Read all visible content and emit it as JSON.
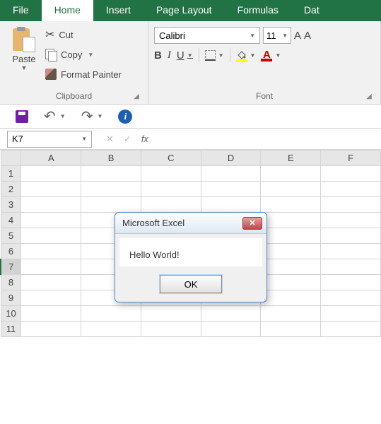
{
  "tabs": {
    "file": "File",
    "home": "Home",
    "insert": "Insert",
    "pagelayout": "Page Layout",
    "formulas": "Formulas",
    "data": "Dat"
  },
  "clipboard": {
    "paste": "Paste",
    "cut": "Cut",
    "copy": "Copy",
    "format_painter": "Format Painter",
    "group_label": "Clipboard"
  },
  "font": {
    "name": "Calibri",
    "size": "11",
    "group_label": "Font",
    "bold": "B",
    "italic": "I",
    "underline": "U",
    "grow": "A",
    "shrink": "A",
    "color_letter": "A"
  },
  "qat": {
    "undo": "↶",
    "redo": "↷",
    "info": "i"
  },
  "namebox": {
    "value": "K7"
  },
  "fbar": {
    "cancel": "✕",
    "enter": "✓",
    "fx": "fx"
  },
  "grid": {
    "cols": [
      "A",
      "B",
      "C",
      "D",
      "E",
      "F"
    ],
    "rows": [
      "1",
      "2",
      "3",
      "4",
      "5",
      "6",
      "7",
      "8",
      "9",
      "10",
      "11"
    ],
    "selected_row_index": 6
  },
  "dialog": {
    "title": "Microsoft Excel",
    "message": "Hello World!",
    "ok": "OK"
  }
}
